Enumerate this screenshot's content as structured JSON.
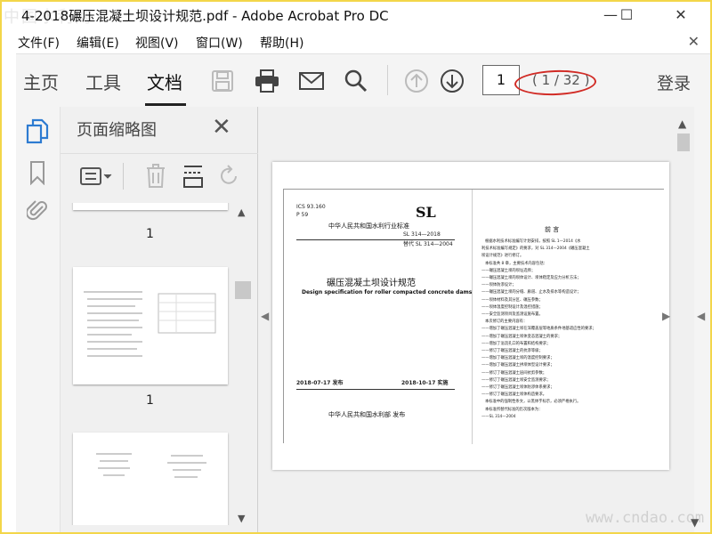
{
  "watermark_top": "中国水利网",
  "watermark_bottom": "www.cndao.com",
  "window": {
    "title": "4-2018碾压混凝土坝设计规范.pdf - Adobe Acrobat Pro DC"
  },
  "menu": [
    "文件(F)",
    "编辑(E)",
    "视图(V)",
    "窗口(W)",
    "帮助(H)"
  ],
  "toolbar": {
    "tabs": [
      "主页",
      "工具",
      "文档"
    ],
    "active_tab": "文档",
    "current_page": "1",
    "page_count": "( 1 / 32 )",
    "login": "登录"
  },
  "panel": {
    "title": "页面缩略图",
    "thumb_labels": [
      "1",
      "1"
    ]
  },
  "page": {
    "ics": "ICS 93.160",
    "ccs": "P 59",
    "std_header": "中华人民共和国水利行业标准",
    "sl_logo": "SL",
    "std_number": "SL 314—2018",
    "replaces": "替代 SL 314—2004",
    "title_cn": "碾压混凝土坝设计规范",
    "title_en": "Design specification for roller compacted concrete dams",
    "issue_date": "2018-07-17 发布",
    "impl_date": "2018-10-17 实施",
    "issuer": "中华人民共和国水利部  发布",
    "foreword": "前    言",
    "foreword_lines": [
      "根据水利技术标准编写计划安排，按照 SL 1—2014《水",
      "利技术标准编写规定》的要求，对 SL 314—2004《碾压混凝土",
      "坝设计规范》进行修订。",
      "本标准共 8 章，主要技术内容包括：",
      "——碾压混凝土坝的坝址选择；",
      "——碾压混凝土坝的坝体设计、坝体稳定及应力分析方法；",
      "——坝体防渗设计；",
      "——碾压混凝土坝的分缝、廊道、止水及排水等构造设计；",
      "——坝体材料及其分区、碾压参数；",
      "——坝体温度控制设计及温控措施；",
      "——安全监测项目及监测设施布置。",
      "本次修订的主要内容有：",
      "——增加了碾压混凝土坝在深覆盖层等地质条件地基适应性的要求；",
      "——增加了碾压混凝土坝体变态混凝土的要求；",
      "——增加了溢流孔口的布置和结构要求；",
      "——修订了碾压混凝土的抗渗等级；",
      "——增加了碾压混凝土坝的温度控制要求；",
      "——增加了碾压混凝土拱坝体型设计要求；",
      "——修订了碾压混凝土层间抗剪参数；",
      "——修订了碾压混凝土坝安全监测要求；",
      "——修订了碾压混凝土坝体防渗体系要求；",
      "——修订了碾压混凝土坝体构造要求。",
      "本标准中的强制性条文，以黑体字标示，必须严格执行。",
      "本标准所替代标准的历次版本为：",
      "——SL 314—2004"
    ]
  }
}
